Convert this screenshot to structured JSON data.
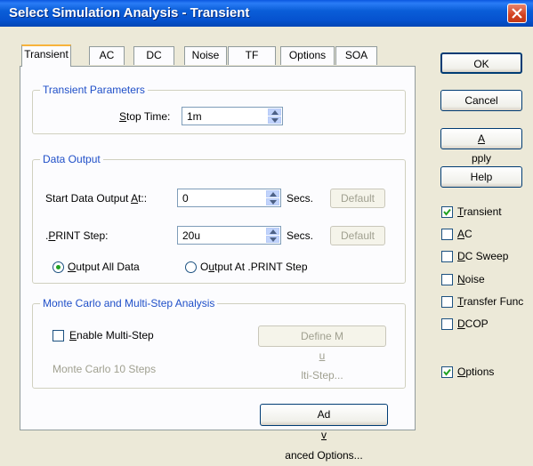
{
  "window": {
    "title": "Select Simulation Analysis - Transient"
  },
  "tabs": [
    {
      "label": "Transient",
      "active": true
    },
    {
      "label": "AC",
      "active": false
    },
    {
      "label": "DC",
      "active": false
    },
    {
      "label": "Noise",
      "active": false
    },
    {
      "label": "TF",
      "active": false
    },
    {
      "label": "Options",
      "active": false
    },
    {
      "label": "SOA",
      "active": false
    }
  ],
  "transient_params": {
    "title": "Transient Parameters",
    "stop_time_label_pre": "",
    "stop_time_label_u": "S",
    "stop_time_label_post": "top Time:",
    "stop_time_value": "1m"
  },
  "data_output": {
    "title": "Data Output",
    "start_label_pre": "Start Data Output ",
    "start_label_u": "A",
    "start_label_post": "t::",
    "start_value": "0",
    "start_unit": "Secs.",
    "start_default": "Default",
    "print_label_pre": ".",
    "print_label_u": "P",
    "print_label_post": "RINT Step:",
    "print_value": "20u",
    "print_unit": "Secs.",
    "print_default": "Default",
    "radio_all_u": "O",
    "radio_all_post": "utput All Data",
    "radio_all_selected": true,
    "radio_print_pre": "O",
    "radio_print_u": "u",
    "radio_print_post": "tput At .PRINT Step",
    "radio_print_selected": false
  },
  "monte_carlo": {
    "title": "Monte Carlo and Multi-Step Analysis",
    "enable_u": "E",
    "enable_post": "nable Multi-Step",
    "enable_checked": false,
    "define_pre": "Define M",
    "define_u": "u",
    "define_post": "lti-Step...",
    "steps_text": "Monte Carlo 10 Steps"
  },
  "advanced": {
    "pre": "Ad",
    "u": "v",
    "post": "anced Options..."
  },
  "buttons": {
    "ok": "OK",
    "cancel": "Cancel",
    "apply_u": "A",
    "apply_post": "pply",
    "help": "Help"
  },
  "analyses": [
    {
      "u": "T",
      "rest": "ransient",
      "checked": true
    },
    {
      "u": "A",
      "rest": "C",
      "checked": false
    },
    {
      "u": "D",
      "rest": "C Sweep",
      "checked": false
    },
    {
      "u": "N",
      "rest": "oise",
      "checked": false
    },
    {
      "u": "T",
      "rest": "ransfer Func",
      "checked": false
    },
    {
      "u": "D",
      "rest": "COP",
      "checked": false
    }
  ],
  "options_check": {
    "u": "O",
    "rest": "ptions",
    "checked": true
  },
  "colors": {
    "title_bar": "#0A5ED8",
    "group_title": "#1F4FC8",
    "tab_highlight": "#F8B33B",
    "dialog_bg": "#ECE9D8"
  }
}
